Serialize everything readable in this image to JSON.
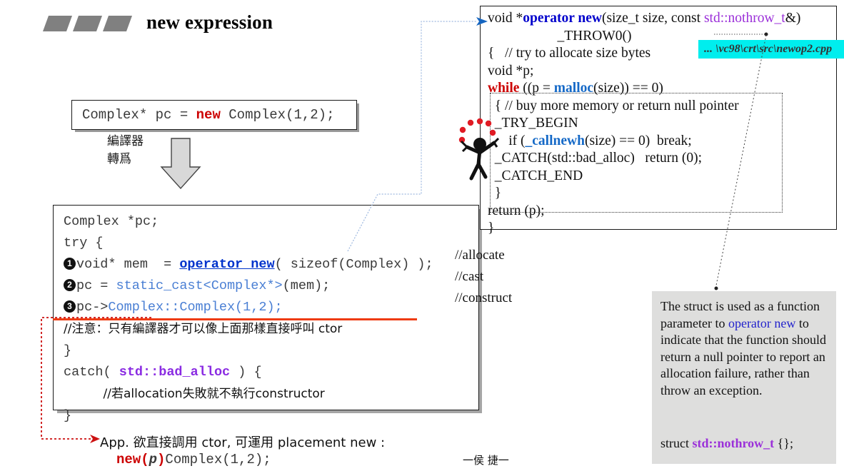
{
  "slide": {
    "title": "new expression",
    "signature": "一侯 捷一"
  },
  "expression": {
    "prefix": "Complex* pc = ",
    "keyword": "new",
    "suffix": " Complex(1,2);"
  },
  "compiler_note": {
    "line1": "編譯器",
    "line2": "轉爲",
    "arrow_icon": "down-arrow-icon"
  },
  "code": {
    "line1": "Complex *pc;",
    "line2": "try {",
    "step1": {
      "num": "1",
      "pre": "void* mem  = ",
      "call": "operator new",
      "post": "( sizeof(Complex) );"
    },
    "step2": {
      "num": "2",
      "pre": "pc = ",
      "code": "static_cast<Complex*>",
      "post": "(mem);"
    },
    "step3": {
      "num": "3",
      "pre": "pc->",
      "code": "Complex::Complex(1,2);"
    },
    "struck_comment": "//注意：只有編譯器才可以像上面那樣直接呼叫 ctor",
    "close_try": "}",
    "catch_open_pre": "catch( ",
    "catch_type": "std::bad_alloc",
    "catch_open_post": " ) {",
    "catch_comment": "//若allocation失敗就不執行constructor",
    "catch_close": "}"
  },
  "side_comments": {
    "allocate": "//allocate",
    "cast": "//cast",
    "construct": "//construct"
  },
  "bottom": {
    "note": "App. 欲直接調用 ctor, 可運用 placement new :",
    "code_kw": "new(",
    "code_var": "p",
    "code_close": ")",
    "code_rest": "Complex(1,2);"
  },
  "source_box": {
    "sig_pre": "void *",
    "sig_fn": "operator new",
    "sig_mid": "(size_t size, const ",
    "sig_type": "std::nothrow_t",
    "sig_post": "&)",
    "throw0": "_THROW0()",
    "brace_comment": "{   // try to allocate size bytes",
    "void_p": "void *p;",
    "while_kw": "while",
    "while_pre": " ((p = ",
    "while_fn": "malloc",
    "while_post": "(size)) == 0)",
    "buy_comment": "{ // buy more memory or return null pointer",
    "try_begin": "_TRY_BEGIN",
    "if_pre": "if (",
    "if_fn": "_callnewh",
    "if_post": "(size) == 0)  break;",
    "catch_line": "_CATCH(std::bad_alloc)   return (0);",
    "catch_end": "_CATCH_END",
    "inner_close": "}",
    "return_line": "return (p);",
    "outer_close": "}"
  },
  "path_label": {
    "text": "... \\vc98\\crt\\src\\newop2.cpp"
  },
  "explanation": {
    "part1": "The struct is used as a function parameter to ",
    "highlight": "operator new",
    "part2": " to indicate that the function should return a null pointer to report an allocation failure, rather than throw an exception.",
    "struct_pre": "struct ",
    "struct_name": "std::nothrow_t",
    "struct_post": " {};"
  },
  "decor": {
    "juggler_icon": "juggling-stick-figure-icon",
    "title_bars_icon": "three-slanted-bars-icon",
    "connector_icon": "dotted-connector-line"
  },
  "colors": {
    "keyword_red": "#cc0000",
    "type_purple": "#9b30d9",
    "call_blue": "#0033cc",
    "cyan_highlight": "#00eeee",
    "strike_orange": "#ee3b11",
    "explain_bg": "#dededd"
  }
}
